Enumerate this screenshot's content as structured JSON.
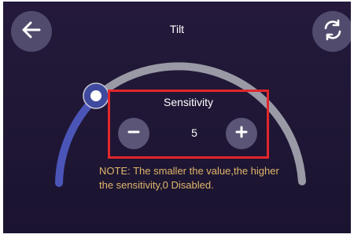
{
  "header": {
    "title": "Tilt",
    "back_icon": "arrow-left-icon",
    "sync_icon": "sync-icon"
  },
  "sensitivity": {
    "label": "Sensitivity",
    "value": "5",
    "minus_icon": "minus-icon",
    "plus_icon": "plus-icon"
  },
  "note": {
    "line1": "NOTE: The smaller the value,the higher",
    "line2": "the sensitivity,0 Disabled."
  },
  "colors": {
    "background": "#211838",
    "arc_inactive": "#9a9aa6",
    "arc_active": "#4b55b8",
    "highlight": "#e2262b",
    "note_text": "#e0b56a"
  }
}
